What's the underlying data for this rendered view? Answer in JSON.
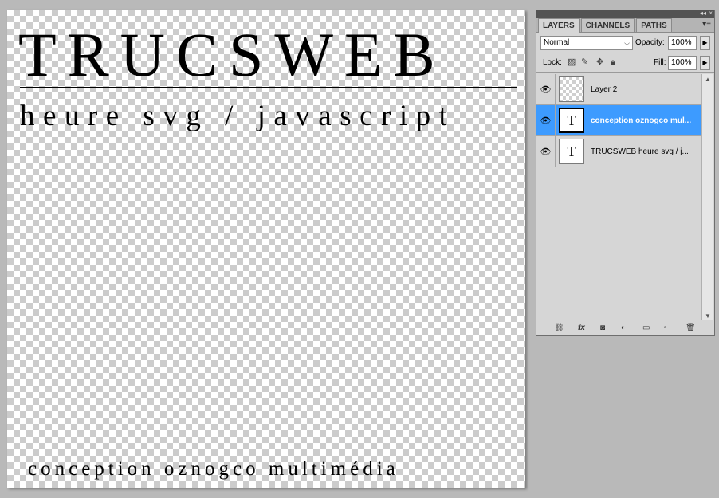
{
  "canvas": {
    "title": "TRUCSWEB",
    "subtitle": "heure svg / javascript",
    "footer": "conception oznogco multimédia"
  },
  "panel": {
    "tabs": [
      {
        "label": "LAYERS",
        "active": true
      },
      {
        "label": "CHANNELS",
        "active": false
      },
      {
        "label": "PATHS",
        "active": false
      }
    ],
    "blend_mode": "Normal",
    "opacity_label": "Opacity:",
    "opacity_value": "100%",
    "lock_label": "Lock:",
    "fill_label": "Fill:",
    "fill_value": "100%",
    "layers": [
      {
        "name": "Layer 2",
        "thumb": "",
        "selected": false
      },
      {
        "name": "conception oznogco mul...",
        "thumb": "T",
        "selected": true
      },
      {
        "name": "TRUCSWEB heure svg / j...",
        "thumb": "T",
        "selected": false
      }
    ]
  },
  "colors": {
    "selection": "#3d9bff",
    "panel_bg": "#d6d6d6",
    "workspace": "#b9b9b9"
  }
}
